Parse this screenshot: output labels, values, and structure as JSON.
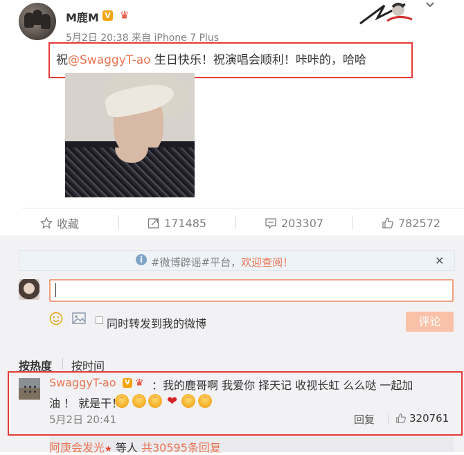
{
  "post": {
    "username": "M鹿M",
    "meta": "5月2日 20:38 来自 iPhone 7 Plus",
    "text_prefix": "祝",
    "mention": "@SwaggyT-ao",
    "text_suffix": " 生日快乐！祝演唱会顺利！咔咔的，哈哈"
  },
  "actions": {
    "favorite": "收藏",
    "repost_count": "171485",
    "comment_count": "203307",
    "like_count": "782572"
  },
  "notice": {
    "text": "#微博辟谣#平台，",
    "highlight": "欢迎查阅！",
    "close": "✕"
  },
  "composer": {
    "forward_label": "同时转发到我的微博",
    "submit_label": "评论"
  },
  "sort": {
    "hot": "按热度",
    "time": "按时间"
  },
  "comment": {
    "username": "SwaggyT-ao",
    "text_line1": "：我的鹿哥啊 我爱你  择天记 收视长虹 么么哒  一起加",
    "text_line2": "油 ！ 就是干！",
    "date": "5月2日 20:41",
    "reply_label": "回复",
    "like_count": "320761"
  },
  "sub_reply": {
    "user": "阿庚会发光",
    "mid": "等人 ",
    "count": "共30595条回复"
  },
  "colors": {
    "accent": "#eb7350",
    "highlight_box": "#e53935",
    "vip_badge": "#f2a412"
  }
}
